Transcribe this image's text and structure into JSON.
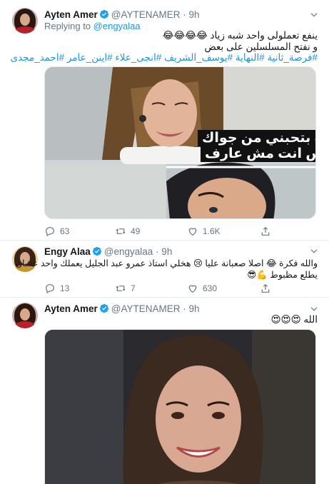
{
  "tweets": [
    {
      "author_name": "Ayten Amer",
      "handle": "@AYTENAMER",
      "time": "· 9h",
      "replying_prefix": "Replying to",
      "replying_mention": "@engyalaa",
      "text_line1": "ينفع تعملولى واحد شبه زياد 😂😂😂😂",
      "text_line2": "و نفتح المسلسلين على بعض",
      "hashtags": "#فرصة_ثانية #النهاية #يوسف_الشريف #انجى_علاء #اينن_عامر #احمد_مجدى",
      "media_caption_line1": "انت بتحبني من جواك",
      "media_caption_line2": "بس انت مش عارف",
      "actions": {
        "reply": "63",
        "retweet": "49",
        "like": "1.6K"
      }
    },
    {
      "author_name": "Engy Alaa",
      "handle": "@engyalaa",
      "time": "· 9h",
      "text_line1": "والله فكرة 😂 اصلا صعبانة عليا 😢 هخلي استاذ عمرو عبد الجليل يعملك واحد عشان",
      "text_line2": "يطلع مظبوط 💪😎",
      "actions": {
        "reply": "13",
        "retweet": "7",
        "like": "630"
      }
    },
    {
      "author_name": "Ayten Amer",
      "handle": "@AYTENAMER",
      "time": "· 9h",
      "text_line1": "الله 😍😍😍",
      "actions": {
        "reply": "",
        "retweet": "",
        "like": ""
      }
    }
  ],
  "colors": {
    "link": "#1b95e0",
    "verified": "#1da1f2",
    "muted": "#657786",
    "divider": "#e6ecf0"
  },
  "icons": [
    "reply-icon",
    "retweet-icon",
    "like-icon",
    "share-icon",
    "verified-badge-icon",
    "chevron-down-icon"
  ]
}
